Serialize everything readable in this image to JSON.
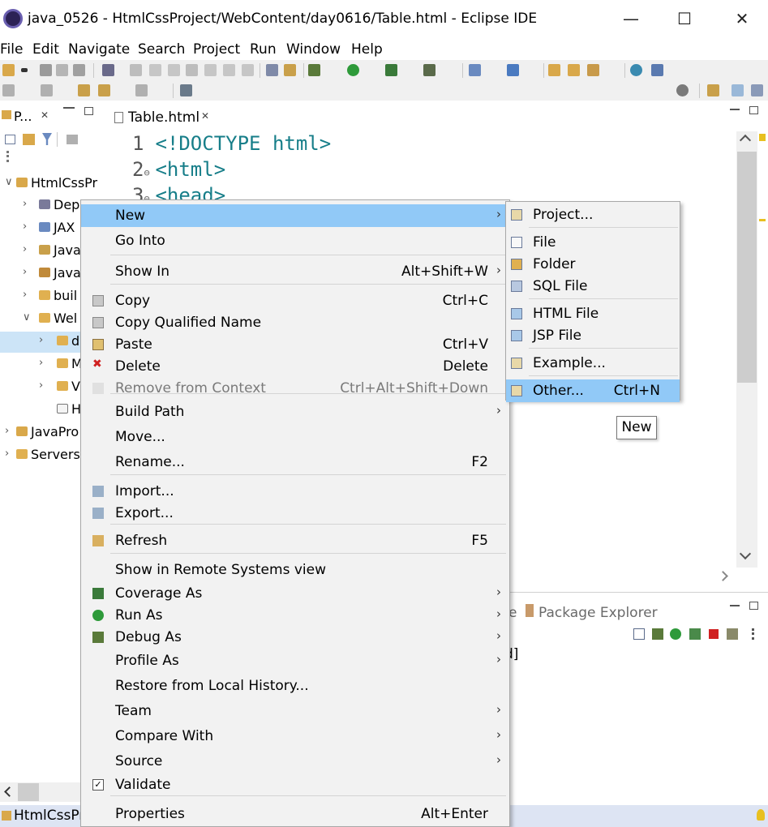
{
  "window": {
    "title": "java_0526 - HtmlCssProject/WebContent/day0616/Table.html - Eclipse IDE",
    "minimize": "—",
    "maximize": "☐",
    "close": "✕"
  },
  "menubar": [
    "File",
    "Edit",
    "Navigate",
    "Search",
    "Project",
    "Run",
    "Window",
    "Help"
  ],
  "left_pane": {
    "tab_label": "P...",
    "tab_close": "✕",
    "tree": [
      {
        "label": "HtmlCssPr",
        "arrow": "∨",
        "icon": "project-icon"
      },
      {
        "label": "Dep",
        "arrow": "›",
        "icon": "deployment-icon"
      },
      {
        "label": "JAX",
        "arrow": "›",
        "icon": "jaxws-icon"
      },
      {
        "label": "Java",
        "arrow": "›",
        "icon": "java-resources-icon"
      },
      {
        "label": "Java",
        "arrow": "›",
        "icon": "java-library-icon"
      },
      {
        "label": "buil",
        "arrow": "›",
        "icon": "folder-icon"
      },
      {
        "label": "Wel",
        "arrow": "∨",
        "icon": "folder-open-icon"
      },
      {
        "label": "d",
        "arrow": "›",
        "icon": "folder-icon"
      },
      {
        "label": "M",
        "arrow": "›",
        "icon": "folder-icon"
      },
      {
        "label": "V",
        "arrow": "›",
        "icon": "folder-icon"
      },
      {
        "label": "H",
        "arrow": "",
        "icon": "html-file-icon"
      },
      {
        "label": "JavaPro",
        "arrow": "›",
        "icon": "project-icon"
      },
      {
        "label": "Servers",
        "arrow": "›",
        "icon": "folder-icon"
      }
    ]
  },
  "editor": {
    "tab_label": "Table.html",
    "tab_close": "✕",
    "lines": [
      {
        "num": "1",
        "marker": "",
        "code": "<!DOCTYPE html>"
      },
      {
        "num": "2",
        "marker": "⊖",
        "code": "<html>"
      },
      {
        "num": "3",
        "marker": "⊖",
        "code": "<head>"
      }
    ]
  },
  "bottom_pane": {
    "tab_partial": "e",
    "package_explorer": "Package Explorer",
    "text_fragment": "d]"
  },
  "status": {
    "project": "HtmlCssPr"
  },
  "context_menu": {
    "items": [
      {
        "label": "New",
        "shortcut": "",
        "submenu": true,
        "highlighted": true,
        "icon": ""
      },
      {
        "label": "Go Into",
        "shortcut": "",
        "submenu": false,
        "icon": ""
      },
      {
        "label": "Show In",
        "shortcut": "Alt+Shift+W",
        "submenu": true,
        "icon": ""
      },
      {
        "label": "Copy",
        "shortcut": "Ctrl+C",
        "submenu": false,
        "icon": "copy-icon"
      },
      {
        "label": "Copy Qualified Name",
        "shortcut": "",
        "submenu": false,
        "icon": "copy-qualified-icon"
      },
      {
        "label": "Paste",
        "shortcut": "Ctrl+V",
        "submenu": false,
        "icon": "paste-icon"
      },
      {
        "label": "Delete",
        "shortcut": "Delete",
        "submenu": false,
        "icon": "delete-icon"
      },
      {
        "label": "Remove from Context",
        "shortcut": "Ctrl+Alt+Shift+Down",
        "submenu": false,
        "disabled": true,
        "icon": "remove-context-icon"
      },
      {
        "label": "Build Path",
        "shortcut": "",
        "submenu": true,
        "icon": ""
      },
      {
        "label": "Move...",
        "shortcut": "",
        "submenu": false,
        "icon": ""
      },
      {
        "label": "Rename...",
        "shortcut": "F2",
        "submenu": false,
        "icon": ""
      },
      {
        "label": "Import...",
        "shortcut": "",
        "submenu": false,
        "icon": "import-icon"
      },
      {
        "label": "Export...",
        "shortcut": "",
        "submenu": false,
        "icon": "export-icon"
      },
      {
        "label": "Refresh",
        "shortcut": "F5",
        "submenu": false,
        "icon": "refresh-icon"
      },
      {
        "label": "Show in Remote Systems view",
        "shortcut": "",
        "submenu": false,
        "icon": ""
      },
      {
        "label": "Coverage As",
        "shortcut": "",
        "submenu": true,
        "icon": "coverage-icon"
      },
      {
        "label": "Run As",
        "shortcut": "",
        "submenu": true,
        "icon": "run-icon"
      },
      {
        "label": "Debug As",
        "shortcut": "",
        "submenu": true,
        "icon": "debug-icon"
      },
      {
        "label": "Profile As",
        "shortcut": "",
        "submenu": true,
        "icon": ""
      },
      {
        "label": "Restore from Local History...",
        "shortcut": "",
        "submenu": false,
        "icon": ""
      },
      {
        "label": "Team",
        "shortcut": "",
        "submenu": true,
        "icon": ""
      },
      {
        "label": "Compare With",
        "shortcut": "",
        "submenu": true,
        "icon": ""
      },
      {
        "label": "Source",
        "shortcut": "",
        "submenu": true,
        "icon": ""
      },
      {
        "label": "Validate",
        "shortcut": "",
        "submenu": false,
        "icon": "checkbox-checked-icon"
      },
      {
        "label": "Properties",
        "shortcut": "Alt+Enter",
        "submenu": false,
        "icon": ""
      }
    ]
  },
  "new_submenu": {
    "items": [
      {
        "label": "Project...",
        "shortcut": "",
        "icon": "new-project-icon"
      },
      {
        "label": "File",
        "shortcut": "",
        "icon": "new-file-icon"
      },
      {
        "label": "Folder",
        "shortcut": "",
        "icon": "new-folder-icon"
      },
      {
        "label": "SQL File",
        "shortcut": "",
        "icon": "sql-file-icon"
      },
      {
        "label": "HTML File",
        "shortcut": "",
        "icon": "html-file-icon"
      },
      {
        "label": "JSP File",
        "shortcut": "",
        "icon": "jsp-file-icon"
      },
      {
        "label": "Example...",
        "shortcut": "",
        "icon": "example-icon"
      },
      {
        "label": "Other...",
        "shortcut": "Ctrl+N",
        "icon": "other-wizard-icon",
        "highlighted": true
      }
    ]
  },
  "tooltip": "New",
  "colors": {
    "highlight": "#91c9f7",
    "menu_bg": "#f2f2f2",
    "code_tag": "#177e89",
    "toolbar_bg": "#f0f0f0",
    "status_bg": "#dde4f3"
  }
}
